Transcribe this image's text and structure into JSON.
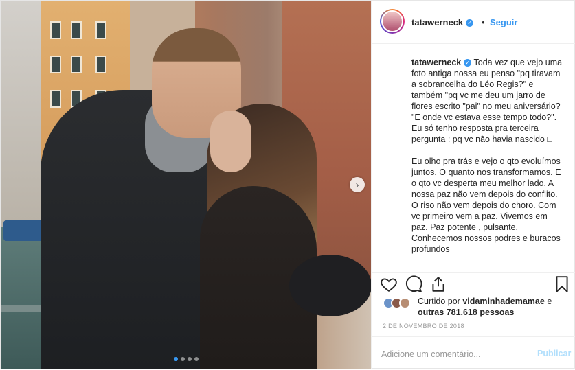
{
  "post": {
    "username": "tatawerneck",
    "follow_label": "Seguir",
    "separator": "•",
    "caption_user": "tatawerneck",
    "caption_paragraphs": [
      "Toda vez que vejo uma foto antiga nossa eu penso \"pq tiravam a sobrancelha do Léo Regis?\" e também \"pq vc me deu um jarro de flores escrito \"pai\" no meu aniversário? \"E onde vc estava esse tempo todo?\". Eu só tenho resposta pra terceira pergunta : pq vc não havia nascido □",
      "Eu olho pra trás e vejo o qto evoluímos juntos. O quanto nos transformamos. E o qto vc desperta meu melhor lado. A nossa paz não vem depois do conflito. O riso não vem depois do choro. Com vc primeiro vem a paz. Vivemos em paz. Paz potente , pulsante. Conhecemos nossos podres e buracos profundos"
    ],
    "likes_prefix": "Curtido por",
    "likes_user": "vidaminhademamae",
    "likes_and": "e",
    "likes_others": "outras 781.618 pessoas",
    "date": "2 DE NOVEMBRO DE 2018",
    "comment_placeholder": "Adicione um comentário...",
    "publish_label": "Publicar",
    "carousel_next": "›",
    "carousel_count": 4,
    "carousel_active_index": 0
  },
  "icons": [
    "heart-icon",
    "comment-icon",
    "share-icon",
    "bookmark-icon",
    "verified-icon",
    "chevron-right-icon"
  ],
  "colors": {
    "link_blue": "#3897f0",
    "text": "#262626",
    "muted": "#999999",
    "publish_disabled": "#b2dffc"
  }
}
